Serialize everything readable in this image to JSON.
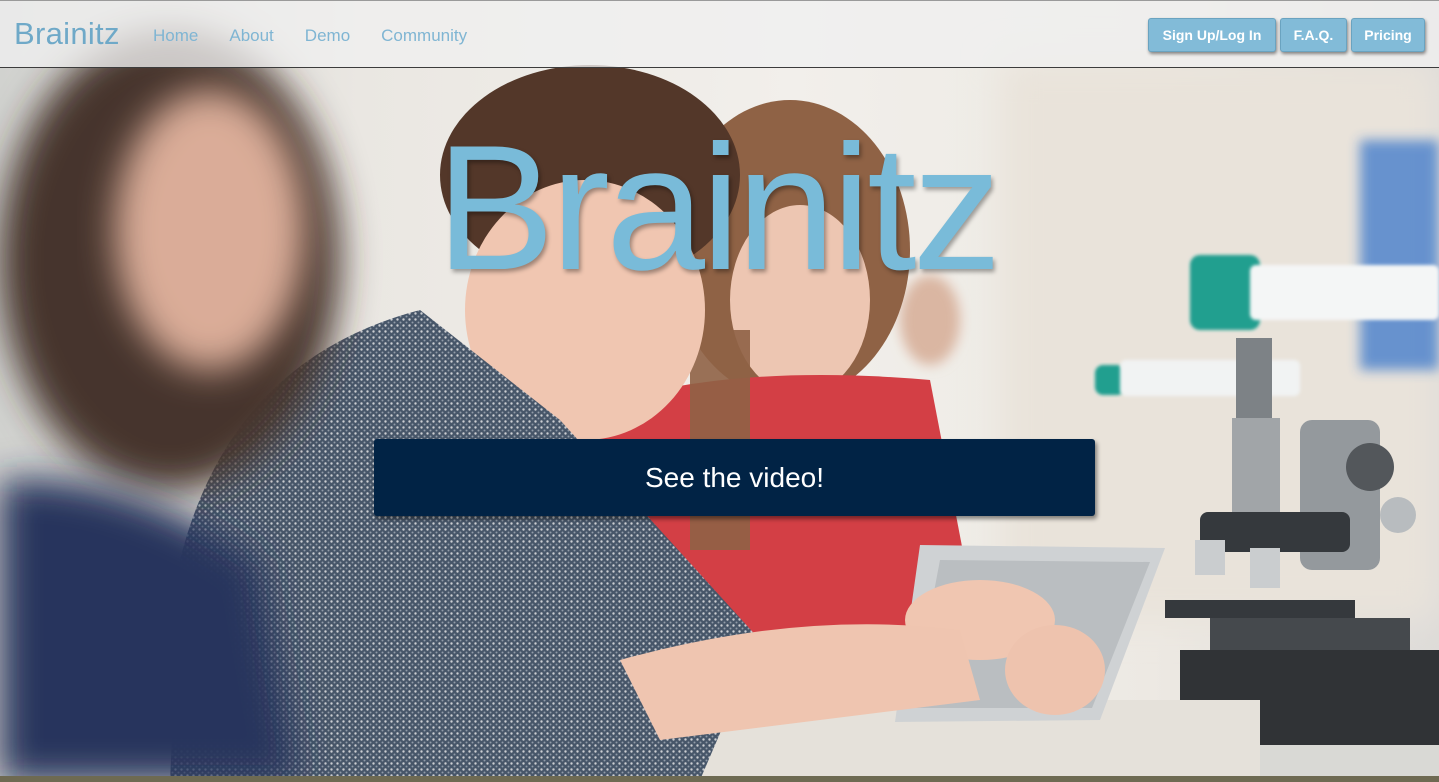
{
  "nav": {
    "brand": "Brainitz",
    "links": [
      "Home",
      "About",
      "Demo",
      "Community"
    ],
    "buttons": {
      "signup": "Sign Up/Log In",
      "faq": "F.A.Q.",
      "pricing": "Pricing"
    }
  },
  "hero": {
    "title": "Brainitz",
    "cta_label": "See the video!"
  },
  "colors": {
    "brand_blue": "#79bbd9",
    "button_blue": "#82bbd8",
    "cta_navy": "#012345"
  }
}
